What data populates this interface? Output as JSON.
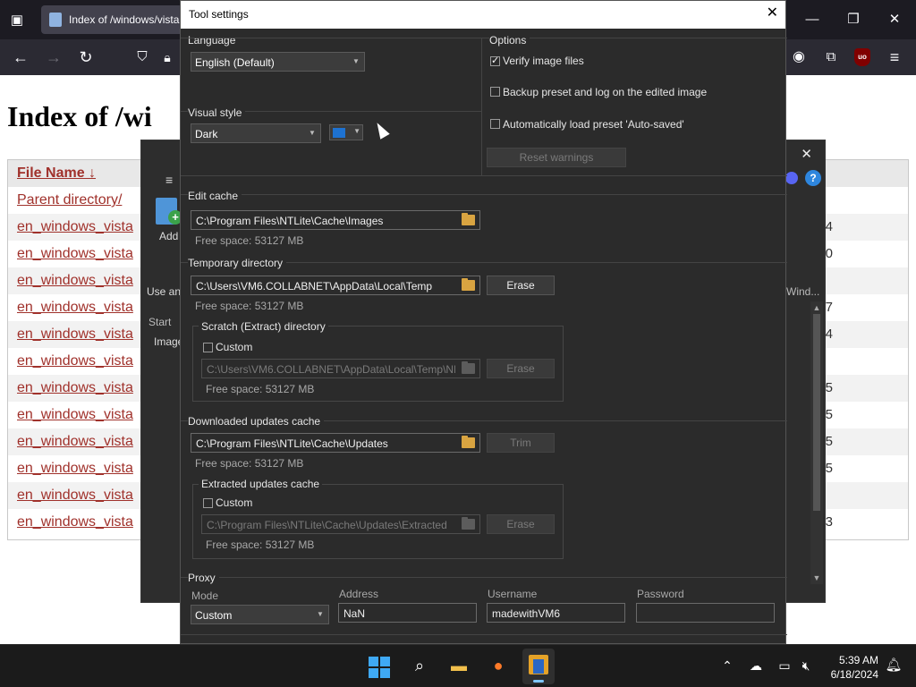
{
  "browser": {
    "tab_title": "Index of /windows/vista",
    "heading": "Index of /wi",
    "column_header": "File Name  ↓",
    "rows": [
      {
        "name": "Parent directory/",
        "tail": ""
      },
      {
        "name": "en_windows_vista",
        "tail": "4"
      },
      {
        "name": "en_windows_vista",
        "tail": "0"
      },
      {
        "name": "en_windows_vista",
        "tail": ""
      },
      {
        "name": "en_windows_vista",
        "tail": "7"
      },
      {
        "name": "en_windows_vista",
        "tail": "4"
      },
      {
        "name": "en_windows_vista",
        "tail": ""
      },
      {
        "name": "en_windows_vista",
        "tail": "5"
      },
      {
        "name": "en_windows_vista",
        "tail": "5"
      },
      {
        "name": "en_windows_vista",
        "tail": "5"
      },
      {
        "name": "en_windows_vista",
        "tail": "5"
      },
      {
        "name": "en_windows_vista",
        "tail": ""
      },
      {
        "name": "en_windows_vista",
        "tail": "3"
      }
    ]
  },
  "ntlite": {
    "add_label": "Add",
    "use_label": "Use an",
    "start_label": "Start",
    "image_label": "Image",
    "wind_label": "Wind..."
  },
  "dialog": {
    "title": "Tool settings",
    "language": {
      "label": "Language",
      "value": "English (Default)"
    },
    "visual_style": {
      "label": "Visual style",
      "value": "Dark",
      "accent_color": "#1e72d1"
    },
    "options": {
      "label": "Options",
      "verify": {
        "label": "Verify image files",
        "checked": true
      },
      "backup": {
        "label": "Backup preset and log on the edited image",
        "checked": false
      },
      "autoload": {
        "label": "Automatically load preset 'Auto-saved'",
        "checked": false
      },
      "reset_button": "Reset warnings"
    },
    "edit_cache": {
      "label": "Edit cache",
      "path": "C:\\Program Files\\NTLite\\Cache\\Images",
      "free": "Free space: 53127 MB"
    },
    "temp_dir": {
      "label": "Temporary directory",
      "path": "C:\\Users\\VM6.COLLABNET\\AppData\\Local\\Temp",
      "free": "Free space: 53127 MB",
      "erase": "Erase"
    },
    "scratch": {
      "label": "Scratch (Extract) directory",
      "custom": "Custom",
      "path": "C:\\Users\\VM6.COLLABNET\\AppData\\Local\\Temp\\NL",
      "free": "Free space: 53127 MB",
      "erase": "Erase"
    },
    "updates_cache": {
      "label": "Downloaded updates cache",
      "path": "C:\\Program Files\\NTLite\\Cache\\Updates",
      "free": "Free space: 53127 MB",
      "trim": "Trim"
    },
    "extracted": {
      "label": "Extracted updates cache",
      "custom": "Custom",
      "path": "C:\\Program Files\\NTLite\\Cache\\Updates\\Extracted",
      "free": "Free space: 53127 MB",
      "erase": "Erase"
    },
    "proxy": {
      "label": "Proxy",
      "mode_label": "Mode",
      "mode_value": "Custom",
      "address_label": "Address",
      "address_value": "NaN",
      "username_label": "Username",
      "username_value": "madewithVM6",
      "password_label": "Password",
      "password_value": ""
    }
  },
  "taskbar": {
    "time": "5:39 AM",
    "date": "6/18/2024"
  }
}
